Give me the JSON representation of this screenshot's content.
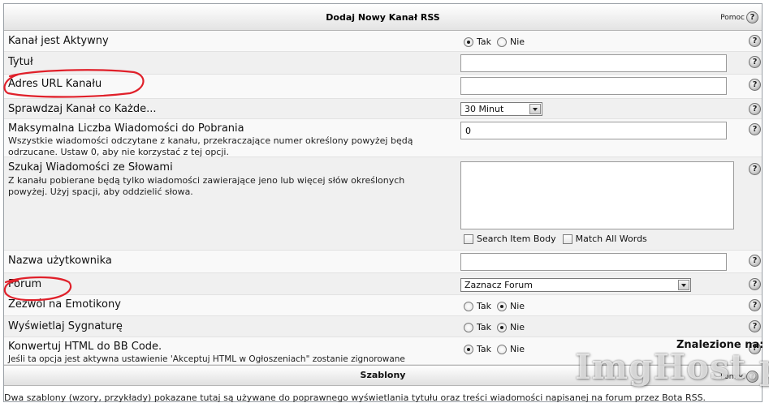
{
  "header": {
    "title": "Dodaj Nowy Kanał RSS",
    "help_label": "Pomoc"
  },
  "rows": {
    "active": {
      "label": "Kanał jest Aktywny",
      "yes": "Tak",
      "no": "Nie",
      "selected": "yes"
    },
    "title": {
      "label": "Tytuł",
      "value": ""
    },
    "url": {
      "label": "Adres URL Kanału",
      "value": ""
    },
    "check": {
      "label": "Sprawdzaj Kanał co Każde...",
      "selected": "30 Minut"
    },
    "max": {
      "label": "Maksymalna Liczba Wiadomości do Pobrania",
      "desc": "Wszystkie wiadomości odczytane z kanału, przekraczające numer określony powyżej będą odrzucane. Ustaw 0, aby nie korzystać z tej opcji.",
      "value": "0"
    },
    "words": {
      "label": "Szukaj Wiadomości ze Słowami",
      "desc": "Z kanału pobierane będą tylko wiadomości zawierające jeno lub więcej słów określonych powyżej. Użyj spacji, aby oddzielić słowa.",
      "search_body": "Search Item Body",
      "match_all": "Match All Words"
    },
    "username": {
      "label": "Nazwa użytkownika",
      "value": ""
    },
    "forum": {
      "label": "Forum",
      "selected": "Zaznacz Forum"
    },
    "smilies": {
      "label": "Zezwól na Emotikony",
      "yes": "Tak",
      "no": "Nie",
      "selected": "no"
    },
    "signature": {
      "label": "Wyświetlaj Sygnaturę",
      "yes": "Tak",
      "no": "Nie",
      "selected": "no"
    },
    "html": {
      "label": "Konwertuj HTML do BB Code.",
      "desc": "Jeśli ta opcja jest aktywna ustawienie 'Akceptuj HTML w Ogłoszeniach\" zostanie zignorowane",
      "yes": "Tak",
      "no": "Nie",
      "selected": "yes"
    }
  },
  "section": {
    "title": "Szablony"
  },
  "footer": {
    "text": "Dwa szablony (wzory, przykłady) pokazane tutaj są używane do poprawnego wyświetlania tytułu oraz treści wiadomości napisanej na forum przez Bota RSS."
  },
  "overlay": {
    "found": "Znalezione na:",
    "watermark": "ImgHost.pl"
  },
  "icons": {
    "help": "help-icon",
    "dropdown": "dropdown-arrow-icon"
  },
  "colors": {
    "annotation": "#e0202a",
    "header_bg": "#e3e3e3"
  }
}
